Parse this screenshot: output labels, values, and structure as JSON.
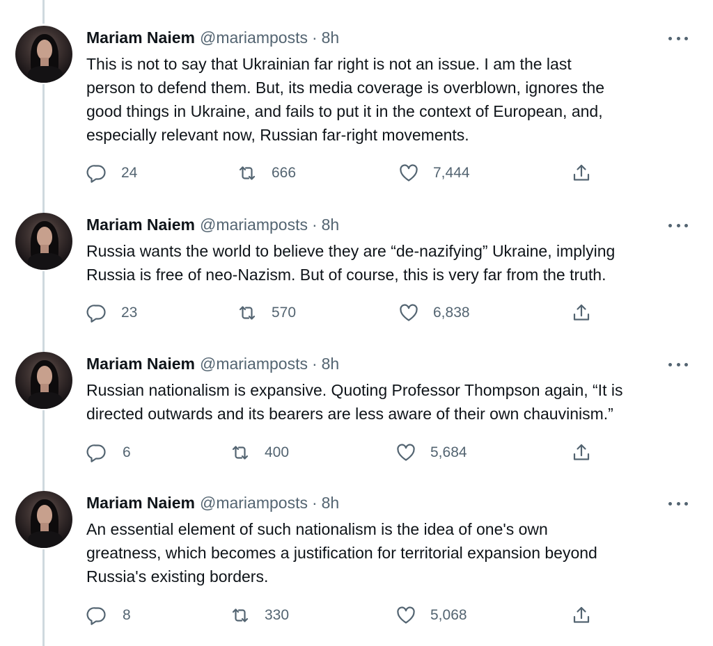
{
  "tweets": [
    {
      "author": "Mariam Naiem",
      "handle": "@mariamposts",
      "separator": "·",
      "time": "8h",
      "lines": [
        "This is not to say that Ukrainian far right is not an issue. I am the last",
        "person to defend them. But, its media coverage is overblown, ignores the",
        "good things in Ukraine, and fails to put it in the context of European, and,",
        "especially relevant now, Russian far-right movements."
      ],
      "replies": "24",
      "retweets": "666",
      "likes": "7,444"
    },
    {
      "author": "Mariam Naiem",
      "handle": "@mariamposts",
      "separator": "·",
      "time": "8h",
      "lines": [
        "Russia wants the world to believe they are “de-nazifying” Ukraine, implying",
        "Russia is free of neo-Nazism. But of course, this is very far from the truth."
      ],
      "replies": "23",
      "retweets": "570",
      "likes": "6,838"
    },
    {
      "author": "Mariam Naiem",
      "handle": "@mariamposts",
      "separator": "·",
      "time": "8h",
      "lines": [
        "Russian nationalism is expansive. Quoting Professor Thompson again, “It is",
        "directed outwards and its bearers are less aware of their own chauvinism.”"
      ],
      "replies": "6",
      "retweets": "400",
      "likes": "5,684"
    },
    {
      "author": "Mariam Naiem",
      "handle": "@mariamposts",
      "separator": "·",
      "time": "8h",
      "lines": [
        "An essential element of such nationalism is the idea of one's own",
        "greatness, which becomes a justification for territorial expansion beyond",
        "Russia's existing borders."
      ],
      "replies": "8",
      "retweets": "330",
      "likes": "5,068"
    }
  ],
  "icons": {
    "reply": "reply-icon",
    "retweet": "retweet-icon",
    "like": "like-icon",
    "share": "share-icon",
    "more": "more-icon"
  },
  "colors": {
    "text": "#0f1419",
    "secondary": "#536471",
    "thread_line": "#cfd9de",
    "background": "#ffffff"
  }
}
